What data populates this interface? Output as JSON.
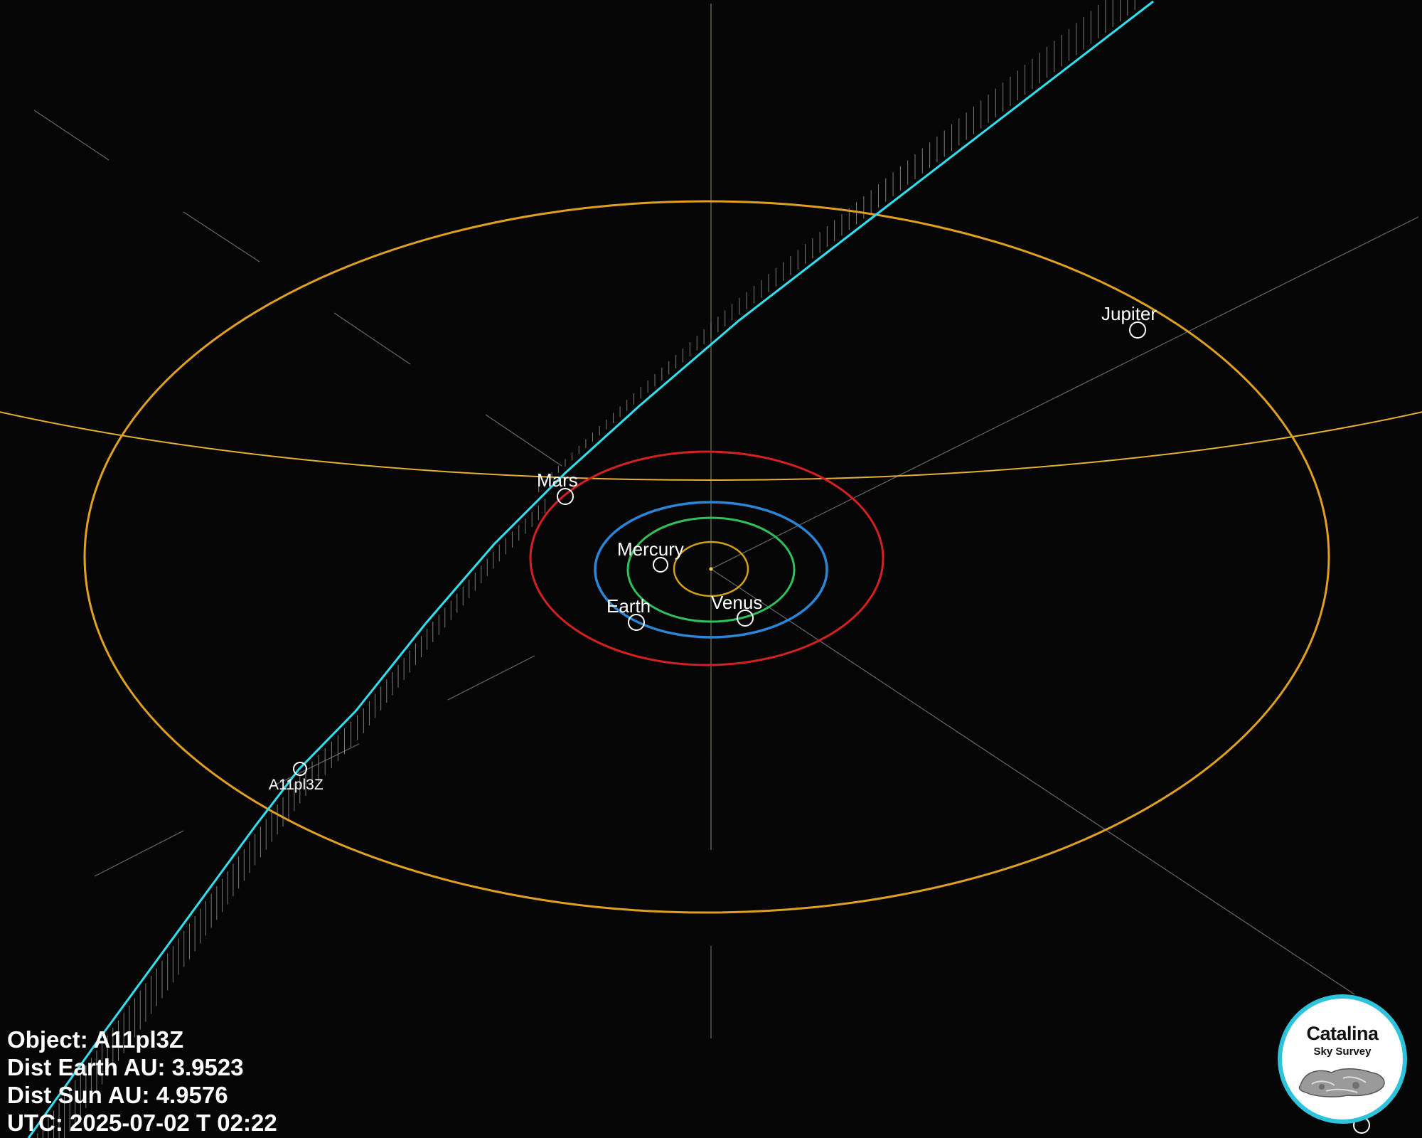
{
  "planets": [
    {
      "name": "Mercury",
      "color": "#d4a017"
    },
    {
      "name": "Venus",
      "color": "#2fc05a"
    },
    {
      "name": "Earth",
      "color": "#2a86d6"
    },
    {
      "name": "Mars",
      "color": "#d42020"
    },
    {
      "name": "Jupiter",
      "color": "#e0a020"
    }
  ],
  "object": {
    "name": "A11pl3Z",
    "path_color": "#2ee0f0"
  },
  "info": {
    "object_label": "Object:",
    "object_value": "A11pl3Z",
    "dist_earth_label": "Dist Earth AU:",
    "dist_earth_value": "3.9523",
    "dist_sun_label": "Dist Sun AU:",
    "dist_sun_value": "4.9576",
    "utc_label": "UTC:",
    "utc_value": "2025-07-02 T 02:22"
  },
  "logo": {
    "line1": "Catalina",
    "line2": "Sky Survey",
    "ring_color": "#2ec3dc"
  }
}
